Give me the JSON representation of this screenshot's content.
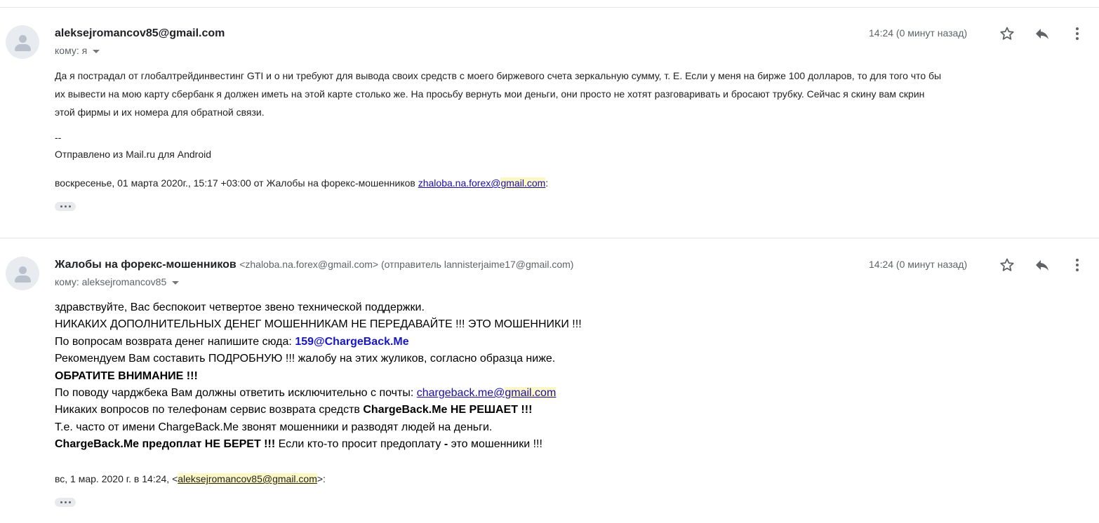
{
  "message1": {
    "sender": "aleksejromancov85@gmail.com",
    "to_label": "кому: я",
    "time": "14:24 (0 минут назад)",
    "body_lines": [
      "Да я пострадал от глобалтрейдинвестинг GTI и о ни требуют для вывода своих средств с моего биржевого счета зеркальную сумму, т. Е. Если у меня на бирже 100 долларов, то для того что бы",
      "их вывести на мою карту сбербанк я должен иметь на этой карте столько же. На просьбу вернуть мои деньги, они просто не хотят разговаривать и бросают трубку. Сейчас я скину вам скрин",
      "этой фирмы и их номера для обратной связи."
    ],
    "sig_sep": "--",
    "signature": "Отправлено из Mail.ru для Android",
    "quote_prefix": "воскресенье, 01 марта 2020г., 15:17 +03:00 от Жалобы на форекс-мошенников ",
    "quote_link_user": "zhaloba.na.forex@",
    "quote_link_domain": "gmail.com",
    "quote_suffix": ":"
  },
  "message2": {
    "sender": "Жалобы на форекс-мошенников",
    "sender_extra": "<zhaloba.na.forex@gmail.com> (отправитель lannisterjaime17@gmail.com)",
    "to_label": "кому: aleksejromancov85",
    "time": "14:24 (0 минут назад)",
    "line1": "здравствуйте, Вас беспокоит четвертое звено технической поддержки.",
    "line2": "НИКАКИХ ДОПОЛНИТЕЛЬНЫХ ДЕНЕГ МОШЕННИКАМ НЕ ПЕРЕДАВАЙТЕ !!! ЭТО МОШЕННИКИ !!!",
    "line3_text": "По вопросам возврата денег напишите сюда: ",
    "line3_email": "159@ChargeBack.Me",
    "line4": "Рекомендуем Вам составить ПОДРОБНУЮ !!! жалобу на этих жуликов, согласно образца ниже.",
    "line5": "ОБРАТИТЕ ВНИМАНИЕ !!!",
    "line6_text": "По поводу чарджбека Вам должны ответить исключительно с почты: ",
    "line6_link_user": "chargeback.me@",
    "line6_link_domain": "gmail.com",
    "line7_text": "Никаких вопросов по телефонам сервис возврата средств ",
    "line7_bold": "ChargeBack.Me НЕ РЕШАЕТ !!!",
    "line8": "Т.е. часто от имени ChargeBack.Me звонят мошенники и разводят людей на деньги.",
    "line9_bold": "ChargeBack.Me предоплат НЕ БЕРЕТ !!!",
    "line9_text": " Если кто-то просит предоплату ",
    "line9_dash": "-",
    "line9_text2": " это мошенники !!!",
    "quote_prefix": "вс, 1 мар. 2020 г. в 14:24, <",
    "quote_email": "aleksejromancov85@gmail.com",
    "quote_suffix": ">:"
  },
  "icons": [
    "avatar-icon",
    "star-icon",
    "reply-icon",
    "more-icon",
    "dropdown-caret-icon",
    "ellipsis-icon"
  ]
}
